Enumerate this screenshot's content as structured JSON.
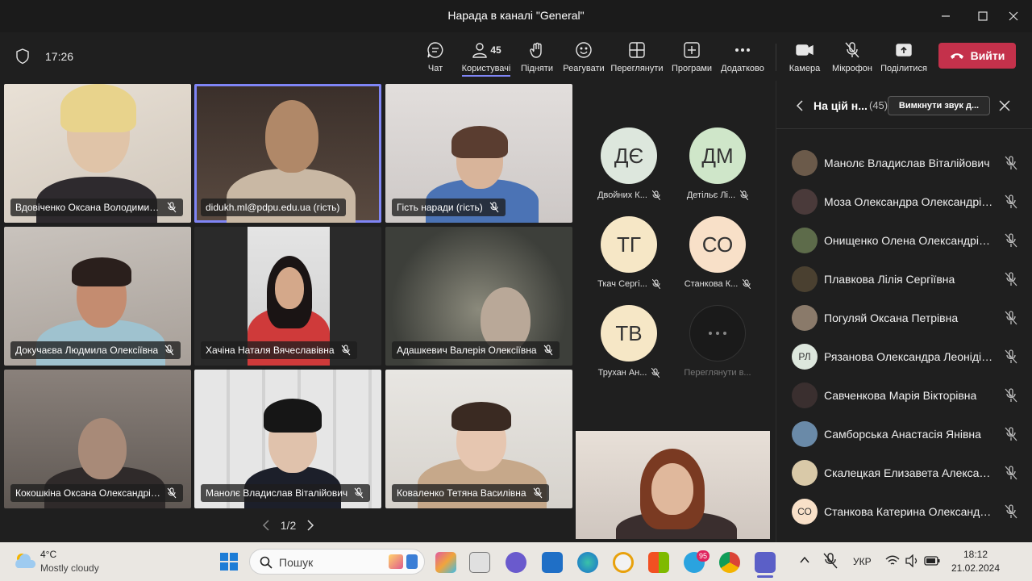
{
  "window": {
    "title": "Нарада в каналі \"General\""
  },
  "toolbar": {
    "time": "17:26",
    "chat": "Чат",
    "people": "Користувачі",
    "people_count": "45",
    "raise": "Підняти",
    "react": "Реагувати",
    "view": "Переглянути",
    "apps": "Програми",
    "more": "Додатково",
    "camera": "Камера",
    "mic": "Мікрофон",
    "share": "Поділитися",
    "leave": "Вийти"
  },
  "tiles": [
    {
      "name": "Вдовіченко Оксана Володимирівна"
    },
    {
      "name": "didukh.ml@pdpu.edu.ua (гість)"
    },
    {
      "name": "Гість наради (гість)"
    },
    {
      "name": "Докучаєва Людмила Олексіївна"
    },
    {
      "name": "Хачіна Наталя Вячеславівна"
    },
    {
      "name": "Адашкевич Валерія Олексіївна"
    },
    {
      "name": "Кокошкіна Оксана Олександрівна"
    },
    {
      "name": "Манолє Владислав Віталійович"
    },
    {
      "name": "Коваленко Тетяна Василівна"
    }
  ],
  "pager": {
    "label": "1/2"
  },
  "avatars": [
    {
      "initials": "ДЄ",
      "name": "Двойних К...",
      "color": "#dde7dd"
    },
    {
      "initials": "ДМ",
      "name": "Детільє Лі...",
      "color": "#cfe6c9"
    },
    {
      "initials": "ТГ",
      "name": "Ткач Сергі...",
      "color": "#f6e7c6"
    },
    {
      "initials": "СО",
      "name": "Станкова К...",
      "color": "#f8e0c8"
    },
    {
      "initials": "ТВ",
      "name": "Трухан Ан...",
      "color": "#f6e7c6"
    },
    {
      "initials": "",
      "name": "Переглянути в...",
      "color": "#2b2b2b"
    }
  ],
  "panel": {
    "title": "На цій н...",
    "count": "(45)",
    "mute_all": "Вимкнути звук д...",
    "people": [
      {
        "name": "Манолє Владислав Віталійович",
        "initials": "",
        "color": "#6b5a4a"
      },
      {
        "name": "Моза Олександра Олександрівна",
        "initials": "",
        "color": "#4a3a3a"
      },
      {
        "name": "Онищенко Олена Олександрівна",
        "initials": "",
        "color": "#5d6b4a"
      },
      {
        "name": "Плавкова Лілія Сергіївна",
        "initials": "",
        "color": "#4a4030"
      },
      {
        "name": "Погуляй Оксана Петрівна",
        "initials": "",
        "color": "#8a7a6a"
      },
      {
        "name": "Рязанова Олександра Леонідівна",
        "initials": "РЛ",
        "color": "#dde7dd"
      },
      {
        "name": "Савченкова Марія Вікторівна",
        "initials": "",
        "color": "#3a2f2f"
      },
      {
        "name": "Самборська Анастасія Янівна",
        "initials": "",
        "color": "#6a8aa8"
      },
      {
        "name": "Скалецкая Елизавета Александровна",
        "initials": "",
        "color": "#d9c9a8"
      },
      {
        "name": "Станкова Катерина Олександрівна",
        "initials": "СО",
        "color": "#f8e0c8"
      }
    ]
  },
  "taskbar": {
    "weather_temp": "4°C",
    "weather_desc": "Mostly cloudy",
    "search": "Пошук",
    "telegram_badge": "95",
    "lang": "УКР",
    "time": "18:12",
    "date": "21.02.2024"
  }
}
